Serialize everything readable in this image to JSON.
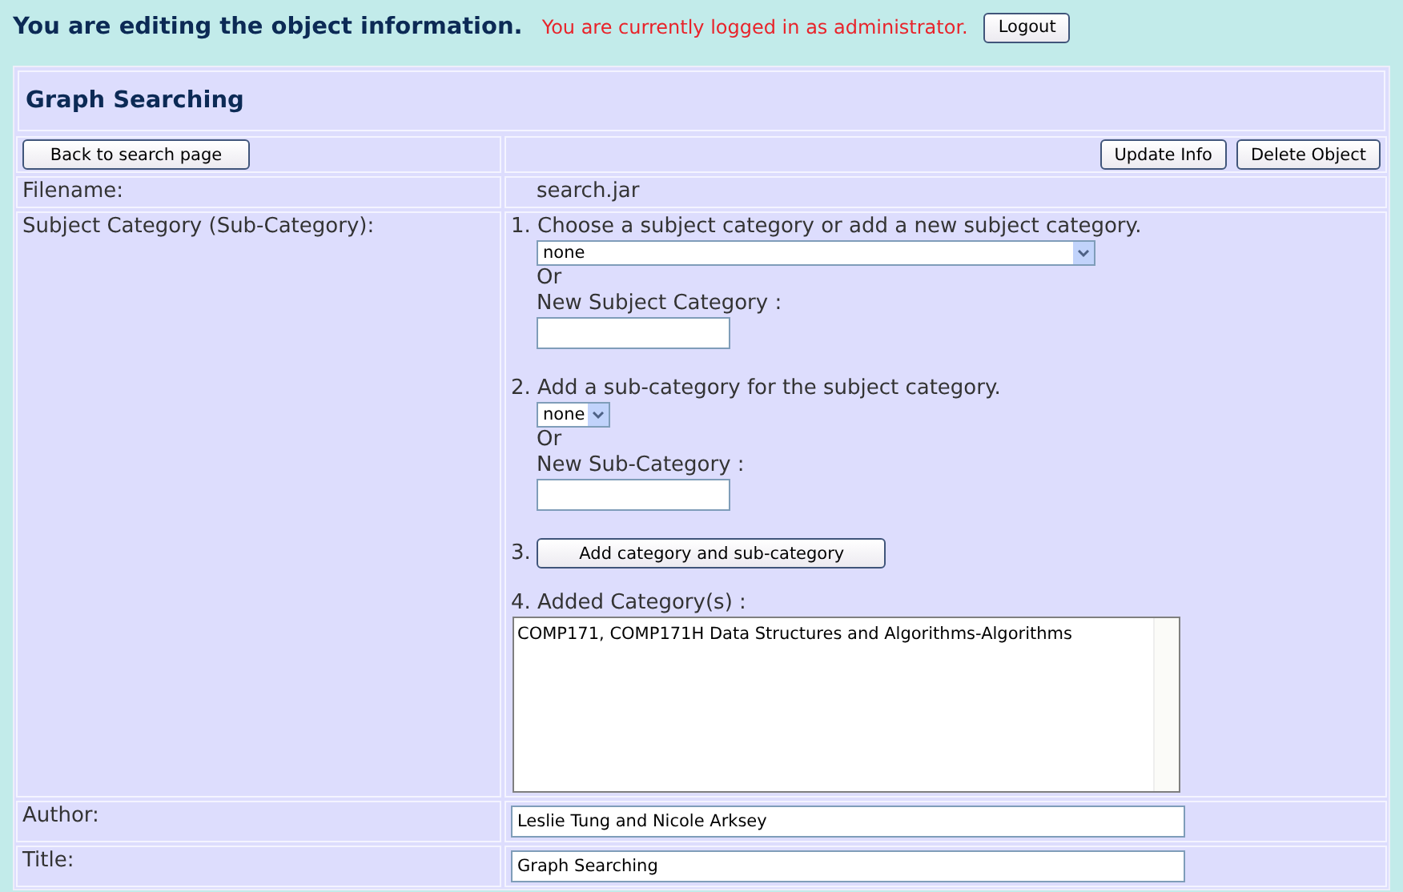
{
  "header": {
    "title": "You are editing the object information.",
    "login_message": "You are currently logged in as administrator.",
    "logout_button": "Logout"
  },
  "object_title": "Graph Searching",
  "toolbar": {
    "back_button": "Back to search page",
    "buttons": [
      "Update Info",
      "Delete Object"
    ]
  },
  "filename": {
    "label": "Filename:",
    "value": "search.jar"
  },
  "subject_category": {
    "label": "Subject Category (Sub-Category):",
    "step_1": {
      "text": "1. Choose a subject category or add a new subject category.",
      "select_value": "none",
      "or": "Or",
      "new_label": "New Subject Category :"
    },
    "step_2": {
      "text": "2. Add a sub-category for the subject category.",
      "select_value": "none",
      "or": "Or",
      "new_label": "New Sub-Category :"
    },
    "step_3": {
      "number": "3.",
      "button": "Add category and sub-category"
    },
    "step_4": {
      "text": "4. Added Category(s) :",
      "value": "COMP171, COMP171H Data Structures and Algorithms-Algorithms"
    }
  },
  "fields": [
    {
      "label": "Author:",
      "value": "Leslie Tung and Nicole Arksey"
    },
    {
      "label": "Title:",
      "value": "Graph Searching"
    }
  ]
}
